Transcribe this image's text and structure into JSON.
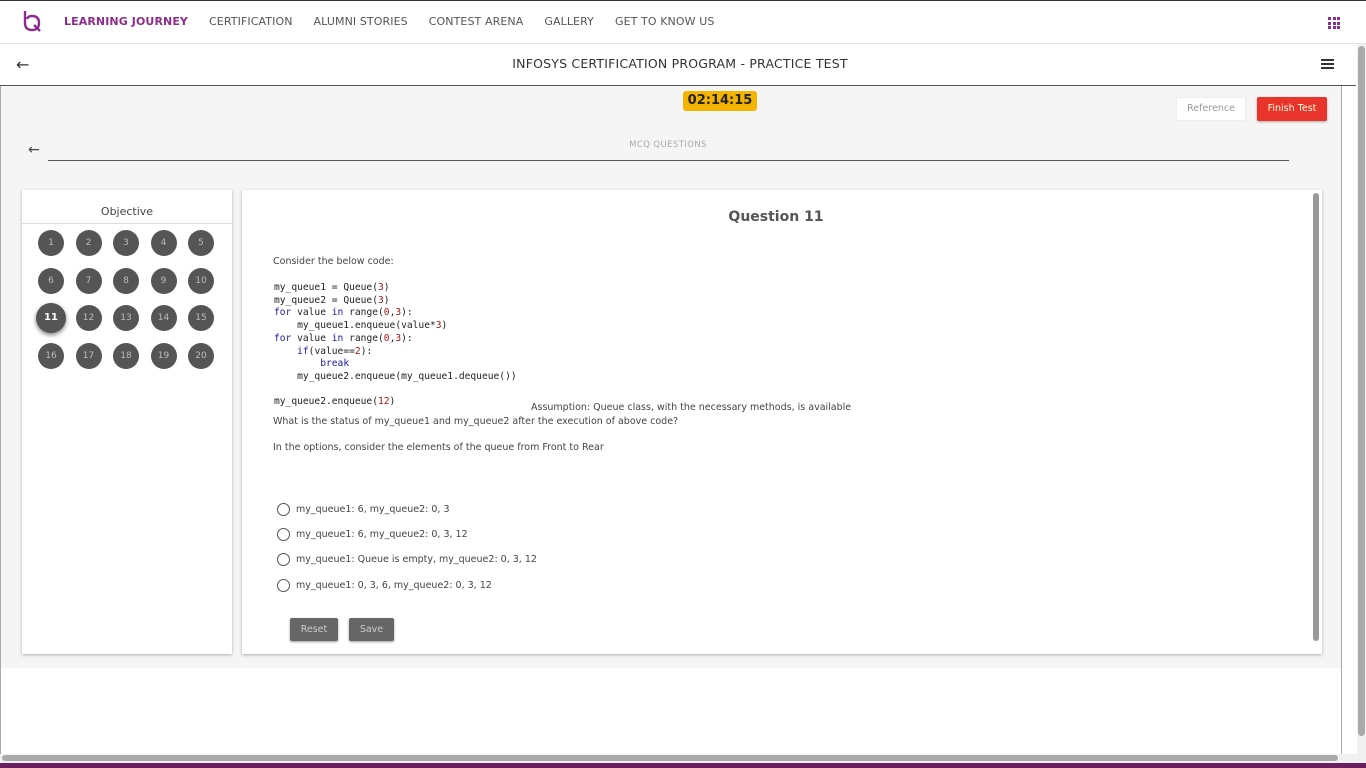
{
  "nav": {
    "logo": "LQ",
    "links": [
      "LEARNING JOURNEY",
      "CERTIFICATION",
      "ALUMNI STORIES",
      "CONTEST ARENA",
      "GALLERY",
      "GET TO KNOW US"
    ],
    "active_index": 0
  },
  "header": {
    "title": "INFOSYS CERTIFICATION PROGRAM - PRACTICE TEST"
  },
  "test": {
    "timer": "02:14:15",
    "reference_label": "Reference",
    "finish_label": "Finish Test",
    "section_label": "MCQ QUESTIONS"
  },
  "sidebar": {
    "title": "Objective",
    "questions": [
      "1",
      "2",
      "3",
      "4",
      "5",
      "6",
      "7",
      "8",
      "9",
      "10",
      "11",
      "12",
      "13",
      "14",
      "15",
      "16",
      "17",
      "18",
      "19",
      "20"
    ],
    "current": "11"
  },
  "question": {
    "title": "Question 11",
    "intro": "Consider the below code:",
    "code_lines": [
      "my_queue1 = Queue(3)",
      "my_queue2 = Queue(3)",
      "for value in range(0,3):",
      "    my_queue1.enqueue(value*3)",
      "for value in range(0,3):",
      "    if(value==2):",
      "        break",
      "    my_queue2.enqueue(my_queue1.dequeue())",
      "",
      "my_queue2.enqueue(12)"
    ],
    "assumption": "Assumption: Queue class, with the necessary methods, is available",
    "prompt": "What is the status of my_queue1 and my_queue2 after the execution of above code?",
    "note": "In the options, consider the elements of the queue from Front to Rear",
    "options": [
      "my_queue1: 6, my_queue2: 0, 3",
      "my_queue1: 6, my_queue2: 0, 3, 12",
      "my_queue1: Queue is empty, my_queue2: 0, 3, 12",
      "my_queue1: 0, 3, 6, my_queue2: 0, 3, 12"
    ],
    "reset_label": "Reset",
    "save_label": "Save"
  },
  "colors": {
    "brand": "#8e2c8e",
    "timer": "#f5b400",
    "finish": "#e8342a"
  },
  "icons": {
    "back": "arrow-left-icon",
    "menu": "hamburger-icon",
    "apps": "grid-icon"
  }
}
